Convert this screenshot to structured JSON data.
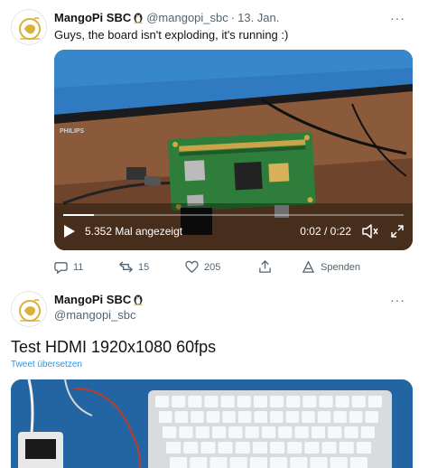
{
  "tweet1": {
    "author_name": "MangoPi SBC",
    "handle": "@mangopi_sbc",
    "separator": "·",
    "date": "13. Jan.",
    "more_label": "···",
    "text": "Guys, the board isn't exploding, it's running :)",
    "video": {
      "views": "5.352 Mal angezeigt",
      "time": "0:02 / 0:22",
      "progress_fraction": 0.09,
      "watermark_brand": "PHILIPS"
    },
    "actions": {
      "replies": "11",
      "retweets": "15",
      "likes": "205",
      "share_label": "",
      "spaces_label": "Spenden"
    }
  },
  "tweet2": {
    "author_name": "MangoPi SBC",
    "handle": "@mangopi_sbc",
    "text": "Test HDMI 1920x1080 60fps",
    "translate_label": "Tweet übersetzen"
  },
  "colors": {
    "text_primary": "#0f1419",
    "text_secondary": "#536471",
    "link": "#1d9bf0",
    "logo_yellow": "#d9b23a"
  }
}
